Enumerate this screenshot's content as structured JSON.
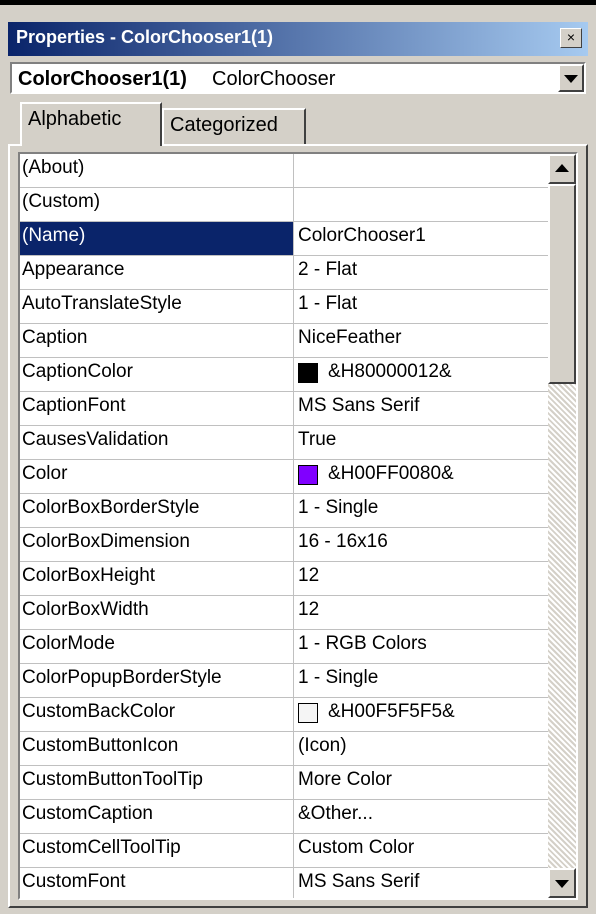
{
  "window": {
    "title": "Properties - ColorChooser1(1)",
    "close_glyph": "×"
  },
  "object_combo": {
    "name": "ColorChooser1(1)",
    "type": "ColorChooser"
  },
  "tabs": [
    {
      "label": "Alphabetic",
      "active": true
    },
    {
      "label": "Categorized",
      "active": false
    }
  ],
  "properties": [
    {
      "name": "(About)",
      "value": ""
    },
    {
      "name": "(Custom)",
      "value": ""
    },
    {
      "name": "(Name)",
      "value": "ColorChooser1",
      "selected": true
    },
    {
      "name": "Appearance",
      "value": "2 - Flat"
    },
    {
      "name": "AutoTranslateStyle",
      "value": "1 - Flat"
    },
    {
      "name": "Caption",
      "value": "NiceFeather"
    },
    {
      "name": "CaptionColor",
      "value": "&H80000012&",
      "swatch": "#000000"
    },
    {
      "name": "CaptionFont",
      "value": "MS Sans Serif"
    },
    {
      "name": "CausesValidation",
      "value": "True"
    },
    {
      "name": "Color",
      "value": "&H00FF0080&",
      "swatch": "#8000ff"
    },
    {
      "name": "ColorBoxBorderStyle",
      "value": "1 - Single"
    },
    {
      "name": "ColorBoxDimension",
      "value": "16 - 16x16"
    },
    {
      "name": "ColorBoxHeight",
      "value": "12"
    },
    {
      "name": "ColorBoxWidth",
      "value": "12"
    },
    {
      "name": "ColorMode",
      "value": "1 - RGB Colors"
    },
    {
      "name": "ColorPopupBorderStyle",
      "value": "1 - Single"
    },
    {
      "name": "CustomBackColor",
      "value": "&H00F5F5F5&",
      "swatch": "#f5f5f5"
    },
    {
      "name": "CustomButtonIcon",
      "value": "(Icon)"
    },
    {
      "name": "CustomButtonToolTip",
      "value": "More Color"
    },
    {
      "name": "CustomCaption",
      "value": "&Other..."
    },
    {
      "name": "CustomCellToolTip",
      "value": "Custom Color"
    },
    {
      "name": "CustomFont",
      "value": "MS Sans Serif"
    }
  ]
}
